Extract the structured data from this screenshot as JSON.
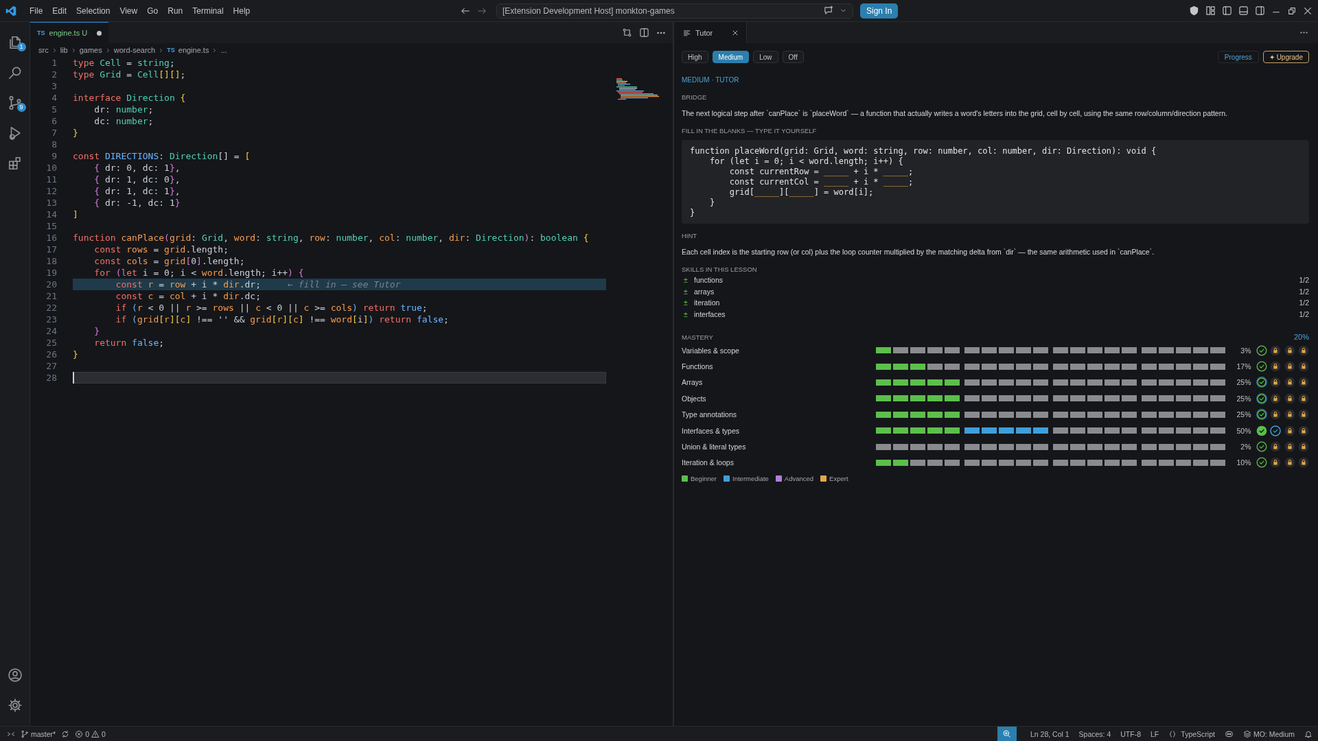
{
  "title_bar": {
    "menu": [
      "File",
      "Edit",
      "Selection",
      "View",
      "Go",
      "Run",
      "Terminal",
      "Help"
    ],
    "command_center": "[Extension Development Host] monkton-games",
    "sign_in": "Sign In"
  },
  "activity_bar": {
    "items": [
      {
        "kind": "files",
        "badge": "1"
      },
      {
        "kind": "search"
      },
      {
        "kind": "source-control",
        "badge": "9"
      },
      {
        "kind": "run"
      },
      {
        "kind": "extensions"
      }
    ],
    "bottom": [
      {
        "kind": "account"
      },
      {
        "kind": "settings"
      }
    ]
  },
  "editor": {
    "tab": {
      "lang": "TS",
      "name": "engine.ts",
      "status": "U",
      "modified": true
    },
    "breadcrumbs": [
      {
        "text": "src"
      },
      {
        "text": "lib"
      },
      {
        "text": "games"
      },
      {
        "text": "word-search"
      },
      {
        "text": "engine.ts",
        "badge": "TS"
      },
      {
        "text": "..."
      }
    ],
    "lines": [
      {
        "no": "1",
        "highlighted": false,
        "current": false,
        "tokens": [
          {
            "kind": "keyword",
            "text": "type "
          },
          {
            "kind": "type",
            "text": "Cell"
          },
          {
            "kind": "plain",
            "text": " = "
          },
          {
            "kind": "type",
            "text": "string"
          },
          {
            "kind": "plain",
            "text": ";"
          }
        ]
      },
      {
        "no": "2",
        "highlighted": false,
        "current": false,
        "tokens": [
          {
            "kind": "keyword",
            "text": "type "
          },
          {
            "kind": "type",
            "text": "Grid"
          },
          {
            "kind": "plain",
            "text": " = "
          },
          {
            "kind": "type",
            "text": "Cell"
          },
          {
            "kind": "brace1",
            "text": "[][]"
          },
          {
            "kind": "plain",
            "text": ";"
          }
        ]
      },
      {
        "no": "3",
        "highlighted": false,
        "current": false
      },
      {
        "no": "4",
        "highlighted": false,
        "current": false,
        "tokens": [
          {
            "kind": "keyword",
            "text": "interface "
          },
          {
            "kind": "type",
            "text": "Direction"
          },
          {
            "kind": "brace1",
            "text": " {"
          }
        ]
      },
      {
        "no": "5",
        "highlighted": false,
        "current": false,
        "tokens": [
          {
            "kind": "plain",
            "text": "    dr: "
          },
          {
            "kind": "type",
            "text": "number"
          },
          {
            "kind": "plain",
            "text": ";"
          }
        ]
      },
      {
        "no": "6",
        "highlighted": false,
        "current": false,
        "tokens": [
          {
            "kind": "plain",
            "text": "    dc: "
          },
          {
            "kind": "type",
            "text": "number"
          },
          {
            "kind": "plain",
            "text": ";"
          }
        ]
      },
      {
        "no": "7",
        "highlighted": false,
        "current": false,
        "tokens": [
          {
            "kind": "brace1",
            "text": "}"
          }
        ]
      },
      {
        "no": "8",
        "highlighted": false,
        "current": false
      },
      {
        "no": "9",
        "highlighted": false,
        "current": false,
        "tokens": [
          {
            "kind": "keyword",
            "text": "const "
          },
          {
            "kind": "const",
            "text": "DIRECTIONS"
          },
          {
            "kind": "plain",
            "text": ": "
          },
          {
            "kind": "type",
            "text": "Direction"
          },
          {
            "kind": "plain",
            "text": "[] = "
          },
          {
            "kind": "brace1",
            "text": "["
          }
        ]
      },
      {
        "no": "10",
        "highlighted": false,
        "current": false,
        "tokens": [
          {
            "kind": "brace2",
            "text": "    {"
          },
          {
            "kind": "plain",
            "text": " dr: 0, dc: 1"
          },
          {
            "kind": "brace2",
            "text": "}"
          },
          {
            "kind": "plain",
            "text": ","
          }
        ]
      },
      {
        "no": "11",
        "highlighted": false,
        "current": false,
        "tokens": [
          {
            "kind": "brace2",
            "text": "    {"
          },
          {
            "kind": "plain",
            "text": " dr: 1, dc: 0"
          },
          {
            "kind": "brace2",
            "text": "}"
          },
          {
            "kind": "plain",
            "text": ","
          }
        ]
      },
      {
        "no": "12",
        "highlighted": false,
        "current": false,
        "tokens": [
          {
            "kind": "brace2",
            "text": "    {"
          },
          {
            "kind": "plain",
            "text": " dr: 1, dc: 1"
          },
          {
            "kind": "brace2",
            "text": "}"
          },
          {
            "kind": "plain",
            "text": ","
          }
        ]
      },
      {
        "no": "13",
        "highlighted": false,
        "current": false,
        "tokens": [
          {
            "kind": "brace2",
            "text": "    {"
          },
          {
            "kind": "plain",
            "text": " dr: -1, dc: 1"
          },
          {
            "kind": "brace2",
            "text": "}"
          }
        ]
      },
      {
        "no": "14",
        "highlighted": false,
        "current": false,
        "tokens": [
          {
            "kind": "brace1",
            "text": "]"
          }
        ]
      },
      {
        "no": "15",
        "highlighted": false,
        "current": false
      },
      {
        "no": "16",
        "highlighted": false,
        "current": false,
        "tokens": [
          {
            "kind": "keyword",
            "text": "function "
          },
          {
            "kind": "var",
            "text": "canPlace"
          },
          {
            "kind": "brace2",
            "text": "("
          },
          {
            "kind": "var",
            "text": "grid"
          },
          {
            "kind": "plain",
            "text": ": "
          },
          {
            "kind": "type",
            "text": "Grid"
          },
          {
            "kind": "plain",
            "text": ", "
          },
          {
            "kind": "var",
            "text": "word"
          },
          {
            "kind": "plain",
            "text": ": "
          },
          {
            "kind": "type",
            "text": "string"
          },
          {
            "kind": "plain",
            "text": ", "
          },
          {
            "kind": "var",
            "text": "row"
          },
          {
            "kind": "plain",
            "text": ": "
          },
          {
            "kind": "type",
            "text": "number"
          },
          {
            "kind": "plain",
            "text": ", "
          },
          {
            "kind": "var",
            "text": "col"
          },
          {
            "kind": "plain",
            "text": ": "
          },
          {
            "kind": "type",
            "text": "number"
          },
          {
            "kind": "plain",
            "text": ", "
          },
          {
            "kind": "var",
            "text": "dir"
          },
          {
            "kind": "plain",
            "text": ": "
          },
          {
            "kind": "type",
            "text": "Direction"
          },
          {
            "kind": "brace2",
            "text": ")"
          },
          {
            "kind": "plain",
            "text": ": "
          },
          {
            "kind": "type",
            "text": "boolean"
          },
          {
            "kind": "brace1",
            "text": " {"
          }
        ]
      },
      {
        "no": "17",
        "highlighted": false,
        "current": false,
        "tokens": [
          {
            "kind": "keyword",
            "text": "    const "
          },
          {
            "kind": "var",
            "text": "rows"
          },
          {
            "kind": "plain",
            "text": " = "
          },
          {
            "kind": "var",
            "text": "grid"
          },
          {
            "kind": "plain",
            "text": ".length;"
          }
        ]
      },
      {
        "no": "18",
        "highlighted": false,
        "current": false,
        "tokens": [
          {
            "kind": "keyword",
            "text": "    const "
          },
          {
            "kind": "var",
            "text": "cols"
          },
          {
            "kind": "plain",
            "text": " = "
          },
          {
            "kind": "var",
            "text": "grid"
          },
          {
            "kind": "brace2",
            "text": "["
          },
          {
            "kind": "plain",
            "text": "0"
          },
          {
            "kind": "brace2",
            "text": "]"
          },
          {
            "kind": "plain",
            "text": ".length;"
          }
        ]
      },
      {
        "no": "19",
        "highlighted": false,
        "current": false,
        "tokens": [
          {
            "kind": "keyword",
            "text": "    for "
          },
          {
            "kind": "brace2",
            "text": "("
          },
          {
            "kind": "keyword",
            "text": "let"
          },
          {
            "kind": "plain",
            "text": " i = 0; i < "
          },
          {
            "kind": "var",
            "text": "word"
          },
          {
            "kind": "plain",
            "text": ".length; i++"
          },
          {
            "kind": "brace2",
            "text": ")"
          },
          {
            "kind": "brace2",
            "text": " {"
          }
        ]
      },
      {
        "no": "20",
        "highlighted": true,
        "current": false,
        "tokens": [
          {
            "kind": "keyword",
            "text": "        const "
          },
          {
            "kind": "var",
            "text": "r"
          },
          {
            "kind": "plain",
            "text": " = "
          },
          {
            "kind": "var",
            "text": "row"
          },
          {
            "kind": "plain",
            "text": " + i * "
          },
          {
            "kind": "var",
            "text": "dir"
          },
          {
            "kind": "plain",
            "text": ".dr;     "
          },
          {
            "kind": "comment",
            "text": "← fill in — see Tutor"
          }
        ]
      },
      {
        "no": "21",
        "highlighted": false,
        "current": false,
        "tokens": [
          {
            "kind": "keyword",
            "text": "        const "
          },
          {
            "kind": "var",
            "text": "c"
          },
          {
            "kind": "plain",
            "text": " = "
          },
          {
            "kind": "var",
            "text": "col"
          },
          {
            "kind": "plain",
            "text": " + i * "
          },
          {
            "kind": "var",
            "text": "dir"
          },
          {
            "kind": "plain",
            "text": ".dc;"
          }
        ]
      },
      {
        "no": "22",
        "highlighted": false,
        "current": false,
        "tokens": [
          {
            "kind": "keyword",
            "text": "        if "
          },
          {
            "kind": "brace3",
            "text": "("
          },
          {
            "kind": "var",
            "text": "r"
          },
          {
            "kind": "plain",
            "text": " < 0 || "
          },
          {
            "kind": "var",
            "text": "r"
          },
          {
            "kind": "plain",
            "text": " >= "
          },
          {
            "kind": "var",
            "text": "rows"
          },
          {
            "kind": "plain",
            "text": " || "
          },
          {
            "kind": "var",
            "text": "c"
          },
          {
            "kind": "plain",
            "text": " < 0 || "
          },
          {
            "kind": "var",
            "text": "c"
          },
          {
            "kind": "plain",
            "text": " >= "
          },
          {
            "kind": "var",
            "text": "cols"
          },
          {
            "kind": "brace3",
            "text": ")"
          },
          {
            "kind": "keyword",
            "text": " return "
          },
          {
            "kind": "const",
            "text": "true"
          },
          {
            "kind": "plain",
            "text": ";"
          }
        ]
      },
      {
        "no": "23",
        "highlighted": false,
        "current": false,
        "tokens": [
          {
            "kind": "keyword",
            "text": "        if "
          },
          {
            "kind": "brace3",
            "text": "("
          },
          {
            "kind": "var",
            "text": "grid"
          },
          {
            "kind": "brace1",
            "text": "["
          },
          {
            "kind": "var",
            "text": "r"
          },
          {
            "kind": "brace1",
            "text": "]["
          },
          {
            "kind": "var",
            "text": "c"
          },
          {
            "kind": "brace1",
            "text": "]"
          },
          {
            "kind": "plain",
            "text": " !== '' && "
          },
          {
            "kind": "var",
            "text": "grid"
          },
          {
            "kind": "brace1",
            "text": "["
          },
          {
            "kind": "var",
            "text": "r"
          },
          {
            "kind": "brace1",
            "text": "]["
          },
          {
            "kind": "var",
            "text": "c"
          },
          {
            "kind": "brace1",
            "text": "]"
          },
          {
            "kind": "plain",
            "text": " !== "
          },
          {
            "kind": "var",
            "text": "word"
          },
          {
            "kind": "brace1",
            "text": "["
          },
          {
            "kind": "plain",
            "text": "i"
          },
          {
            "kind": "brace1",
            "text": "]"
          },
          {
            "kind": "brace3",
            "text": ")"
          },
          {
            "kind": "keyword",
            "text": " return "
          },
          {
            "kind": "const",
            "text": "false"
          },
          {
            "kind": "plain",
            "text": ";"
          }
        ]
      },
      {
        "no": "24",
        "highlighted": false,
        "current": false,
        "tokens": [
          {
            "kind": "brace2",
            "text": "    }"
          }
        ]
      },
      {
        "no": "25",
        "highlighted": false,
        "current": false,
        "tokens": [
          {
            "kind": "keyword",
            "text": "    return "
          },
          {
            "kind": "const",
            "text": "false"
          },
          {
            "kind": "plain",
            "text": ";"
          }
        ]
      },
      {
        "no": "26",
        "highlighted": false,
        "current": false,
        "tokens": [
          {
            "kind": "brace1",
            "text": "}"
          }
        ]
      },
      {
        "no": "27",
        "highlighted": false,
        "current": false
      },
      {
        "no": "28",
        "highlighted": false,
        "current": true
      }
    ]
  },
  "tutor": {
    "tab": "Tutor",
    "levels": [
      {
        "label": "High",
        "selected": false
      },
      {
        "label": "Medium",
        "selected": true
      },
      {
        "label": "Low",
        "selected": false
      },
      {
        "label": "Off",
        "selected": false
      }
    ],
    "progress": "Progress",
    "upgrade": "✦ Upgrade",
    "mode": "MEDIUM · TUTOR",
    "bridge": {
      "heading": "BRIDGE",
      "text": "The next logical step after `canPlace` is `placeWord` — a function that actually writes a word's letters into the grid, cell by cell, using the same row/column/direction pattern."
    },
    "exercise": {
      "heading": "FILL IN THE BLANKS — TYPE IT YOURSELF",
      "lines": [
        [
          {
            "kind": "code",
            "text": "function placeWord(grid: Grid, word: string, row: number, col: number, dir: Direction): void {"
          }
        ],
        [
          {
            "kind": "code",
            "text": "    for (let i = 0; i < word.length; i++) {"
          }
        ],
        [
          {
            "kind": "code",
            "text": "        const currentRow = "
          },
          {
            "kind": "blank",
            "text": "_____"
          },
          {
            "kind": "code",
            "text": " + i * "
          },
          {
            "kind": "blank",
            "text": "_____"
          },
          {
            "kind": "code",
            "text": ";"
          }
        ],
        [
          {
            "kind": "code",
            "text": "        const currentCol = "
          },
          {
            "kind": "blank",
            "text": "_____"
          },
          {
            "kind": "code",
            "text": " + i * "
          },
          {
            "kind": "blank",
            "text": "_____"
          },
          {
            "kind": "code",
            "text": ";"
          }
        ],
        [
          {
            "kind": "code",
            "text": "        grid["
          },
          {
            "kind": "blank",
            "text": "_____"
          },
          {
            "kind": "code",
            "text": "]["
          },
          {
            "kind": "blank",
            "text": "_____"
          },
          {
            "kind": "code",
            "text": "] = word[i];"
          }
        ],
        [
          {
            "kind": "code",
            "text": "    }"
          }
        ],
        [
          {
            "kind": "code",
            "text": "}"
          }
        ]
      ]
    },
    "hint": {
      "heading": "HINT",
      "text": "Each cell index is the starting row (or col) plus the loop counter multiplied by the matching delta from `dir` — the same arithmetic used in `canPlace`."
    },
    "skills": {
      "heading": "SKILLS IN THIS LESSON",
      "items": [
        {
          "mark": "±",
          "name": "functions",
          "count": "1/2"
        },
        {
          "mark": "±",
          "name": "arrays",
          "count": "1/2"
        },
        {
          "mark": "±",
          "name": "iteration",
          "count": "1/2"
        },
        {
          "mark": "±",
          "name": "interfaces",
          "count": "1/2"
        }
      ]
    },
    "mastery": {
      "heading": "MASTERY",
      "overall": "20%",
      "rows": [
        {
          "label": "Variables & scope",
          "tiers": [
            {
              "level": 0.2
            },
            {
              "level": 0
            },
            {
              "level": 0
            },
            {
              "level": 0
            }
          ],
          "percent": "3%",
          "badges": [
            {
              "kind": "earned"
            },
            {
              "kind": "locked"
            },
            {
              "kind": "locked"
            },
            {
              "kind": "locked"
            }
          ]
        },
        {
          "label": "Functions",
          "tiers": [
            {
              "level": 0.6
            },
            {
              "level": 0
            },
            {
              "level": 0
            },
            {
              "level": 0
            }
          ],
          "percent": "17%",
          "badges": [
            {
              "kind": "earned"
            },
            {
              "kind": "locked"
            },
            {
              "kind": "locked"
            },
            {
              "kind": "locked"
            }
          ]
        },
        {
          "label": "Arrays",
          "tiers": [
            {
              "level": 1
            },
            {
              "level": 0
            },
            {
              "level": 0
            },
            {
              "level": 0
            }
          ],
          "percent": "25%",
          "badges": [
            {
              "kind": "earned-focus"
            },
            {
              "kind": "locked"
            },
            {
              "kind": "locked"
            },
            {
              "kind": "locked"
            }
          ]
        },
        {
          "label": "Objects",
          "tiers": [
            {
              "level": 1
            },
            {
              "level": 0
            },
            {
              "level": 0
            },
            {
              "level": 0
            }
          ],
          "percent": "25%",
          "badges": [
            {
              "kind": "earned-focus"
            },
            {
              "kind": "locked"
            },
            {
              "kind": "locked"
            },
            {
              "kind": "locked"
            }
          ]
        },
        {
          "label": "Type annotations",
          "tiers": [
            {
              "level": 1
            },
            {
              "level": 0
            },
            {
              "level": 0
            },
            {
              "level": 0
            }
          ],
          "percent": "25%",
          "badges": [
            {
              "kind": "earned-focus"
            },
            {
              "kind": "locked"
            },
            {
              "kind": "locked"
            },
            {
              "kind": "locked"
            }
          ]
        },
        {
          "label": "Interfaces & types",
          "tiers": [
            {
              "level": 1
            },
            {
              "level": 1
            },
            {
              "level": 0
            },
            {
              "level": 0
            }
          ],
          "percent": "50%",
          "badges": [
            {
              "kind": "complete"
            },
            {
              "kind": "active"
            },
            {
              "kind": "locked"
            },
            {
              "kind": "locked"
            }
          ]
        },
        {
          "label": "Union & literal types",
          "tiers": [
            {
              "level": 0
            },
            {
              "level": 0
            },
            {
              "level": 0
            },
            {
              "level": 0
            }
          ],
          "percent": "2%",
          "badges": [
            {
              "kind": "earned"
            },
            {
              "kind": "locked"
            },
            {
              "kind": "locked"
            },
            {
              "kind": "locked"
            }
          ]
        },
        {
          "label": "Iteration & loops",
          "tiers": [
            {
              "level": 0.4
            },
            {
              "level": 0
            },
            {
              "level": 0
            },
            {
              "level": 0
            }
          ],
          "percent": "10%",
          "badges": [
            {
              "kind": "earned"
            },
            {
              "kind": "locked"
            },
            {
              "kind": "locked"
            },
            {
              "kind": "locked"
            }
          ]
        }
      ],
      "legend": [
        {
          "label": "Beginner",
          "color": "#5cbf4a"
        },
        {
          "label": "Intermediate",
          "color": "#3d9fdb"
        },
        {
          "label": "Advanced",
          "color": "#b07fd9"
        },
        {
          "label": "Expert",
          "color": "#e0a84a"
        }
      ]
    }
  },
  "status_bar": {
    "branch": "master*",
    "errors": "0",
    "warnings": "0",
    "position": "Ln 28, Col 1",
    "indentation": "Spaces: 4",
    "encoding": "UTF-8",
    "eol": "LF",
    "language": "TypeScript",
    "tutor_level": "MO: Medium"
  }
}
